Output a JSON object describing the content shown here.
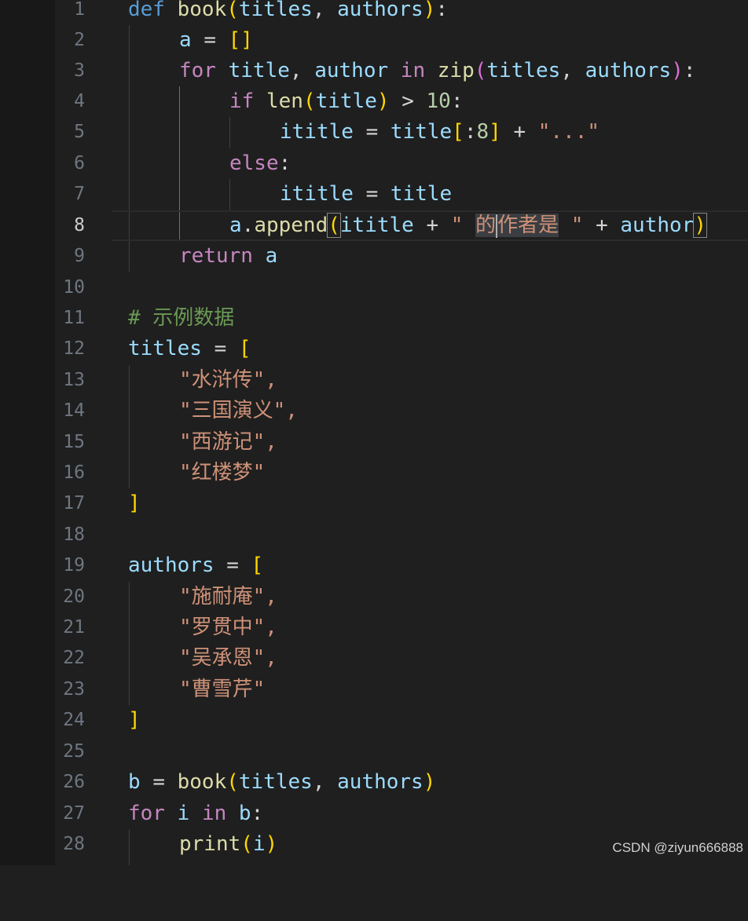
{
  "line_numbers": [
    "1",
    "2",
    "3",
    "4",
    "5",
    "6",
    "7",
    "8",
    "9",
    "10",
    "11",
    "12",
    "13",
    "14",
    "15",
    "16",
    "17",
    "18",
    "19",
    "20",
    "21",
    "22",
    "23",
    "24",
    "25",
    "26",
    "27",
    "28"
  ],
  "active_line": "8",
  "code": {
    "l1": {
      "kw": "def",
      "fn": "book",
      "p_open": "(",
      "a1": "titles",
      ",": ",",
      "a2": "authors",
      "p_close": ")",
      "colon": ":"
    },
    "l2": {
      "var": "a",
      "eq": "=",
      "brackets": "[]"
    },
    "l3": {
      "kw": "for",
      "v1": "title",
      ",": ",",
      "v2": "author",
      "in": "in",
      "fn": "zip",
      "p_open": "(",
      "a1": "titles",
      "a2": "authors",
      "p_close": ")",
      "colon": ":"
    },
    "l4": {
      "kw": "if",
      "fn": "len",
      "p_open": "(",
      "arg": "title",
      "p_close": ")",
      "op": ">",
      "num": "10",
      "colon": ":"
    },
    "l5": {
      "var": "ititle",
      "eq": "=",
      "src": "title",
      "b_open": "[",
      "slice": ":",
      "num": "8",
      "b_close": "]",
      "plus": "+",
      "str": "\"...\""
    },
    "l6": {
      "kw": "else",
      "colon": ":"
    },
    "l7": {
      "var": "ititle",
      "eq": "=",
      "src": "title"
    },
    "l8": {
      "obj": "a",
      "dot": ".",
      "method": "append",
      "p_open": "(",
      "arg": "ititle",
      "plus1": "+",
      "str_start": "\" ",
      "str_hl1": "的",
      "str_mid": "作者是",
      "str_end": " \"",
      "plus2": "+",
      "arg2": "author",
      "p_close": ")"
    },
    "l9": {
      "kw": "return",
      "var": "a"
    },
    "l11": {
      "comment": "# 示例数据"
    },
    "l12": {
      "var": "titles",
      "eq": "=",
      "b": "["
    },
    "titles": [
      "\"水浒传\",",
      "\"三国演义\",",
      "\"西游记\",",
      "\"红楼梦\""
    ],
    "l17": {
      "b": "]"
    },
    "l19": {
      "var": "authors",
      "eq": "=",
      "b": "["
    },
    "authors": [
      "\"施耐庵\",",
      "\"罗贯中\",",
      "\"吴承恩\",",
      "\"曹雪芹\""
    ],
    "l24": {
      "b": "]"
    },
    "l26": {
      "var": "b",
      "eq": "=",
      "fn": "book",
      "p_open": "(",
      "a1": "titles",
      "a2": "authors",
      "p_close": ")"
    },
    "l27": {
      "kw": "for",
      "v": "i",
      "in": "in",
      "it": "b",
      "colon": ":"
    },
    "l28": {
      "fn": "print",
      "p_open": "(",
      "arg": "i",
      "p_close": ")"
    }
  },
  "watermark": "CSDN @ziyun666888",
  "colors": {
    "keyword": "#569cd6",
    "control": "#c586c0",
    "function": "#dcdcaa",
    "variable": "#9cdcfe",
    "string": "#ce9178",
    "number": "#b5cea8",
    "comment": "#6a9955",
    "bracket1": "#ffd700",
    "bracket2": "#da70d6",
    "bracket3": "#179fff"
  }
}
